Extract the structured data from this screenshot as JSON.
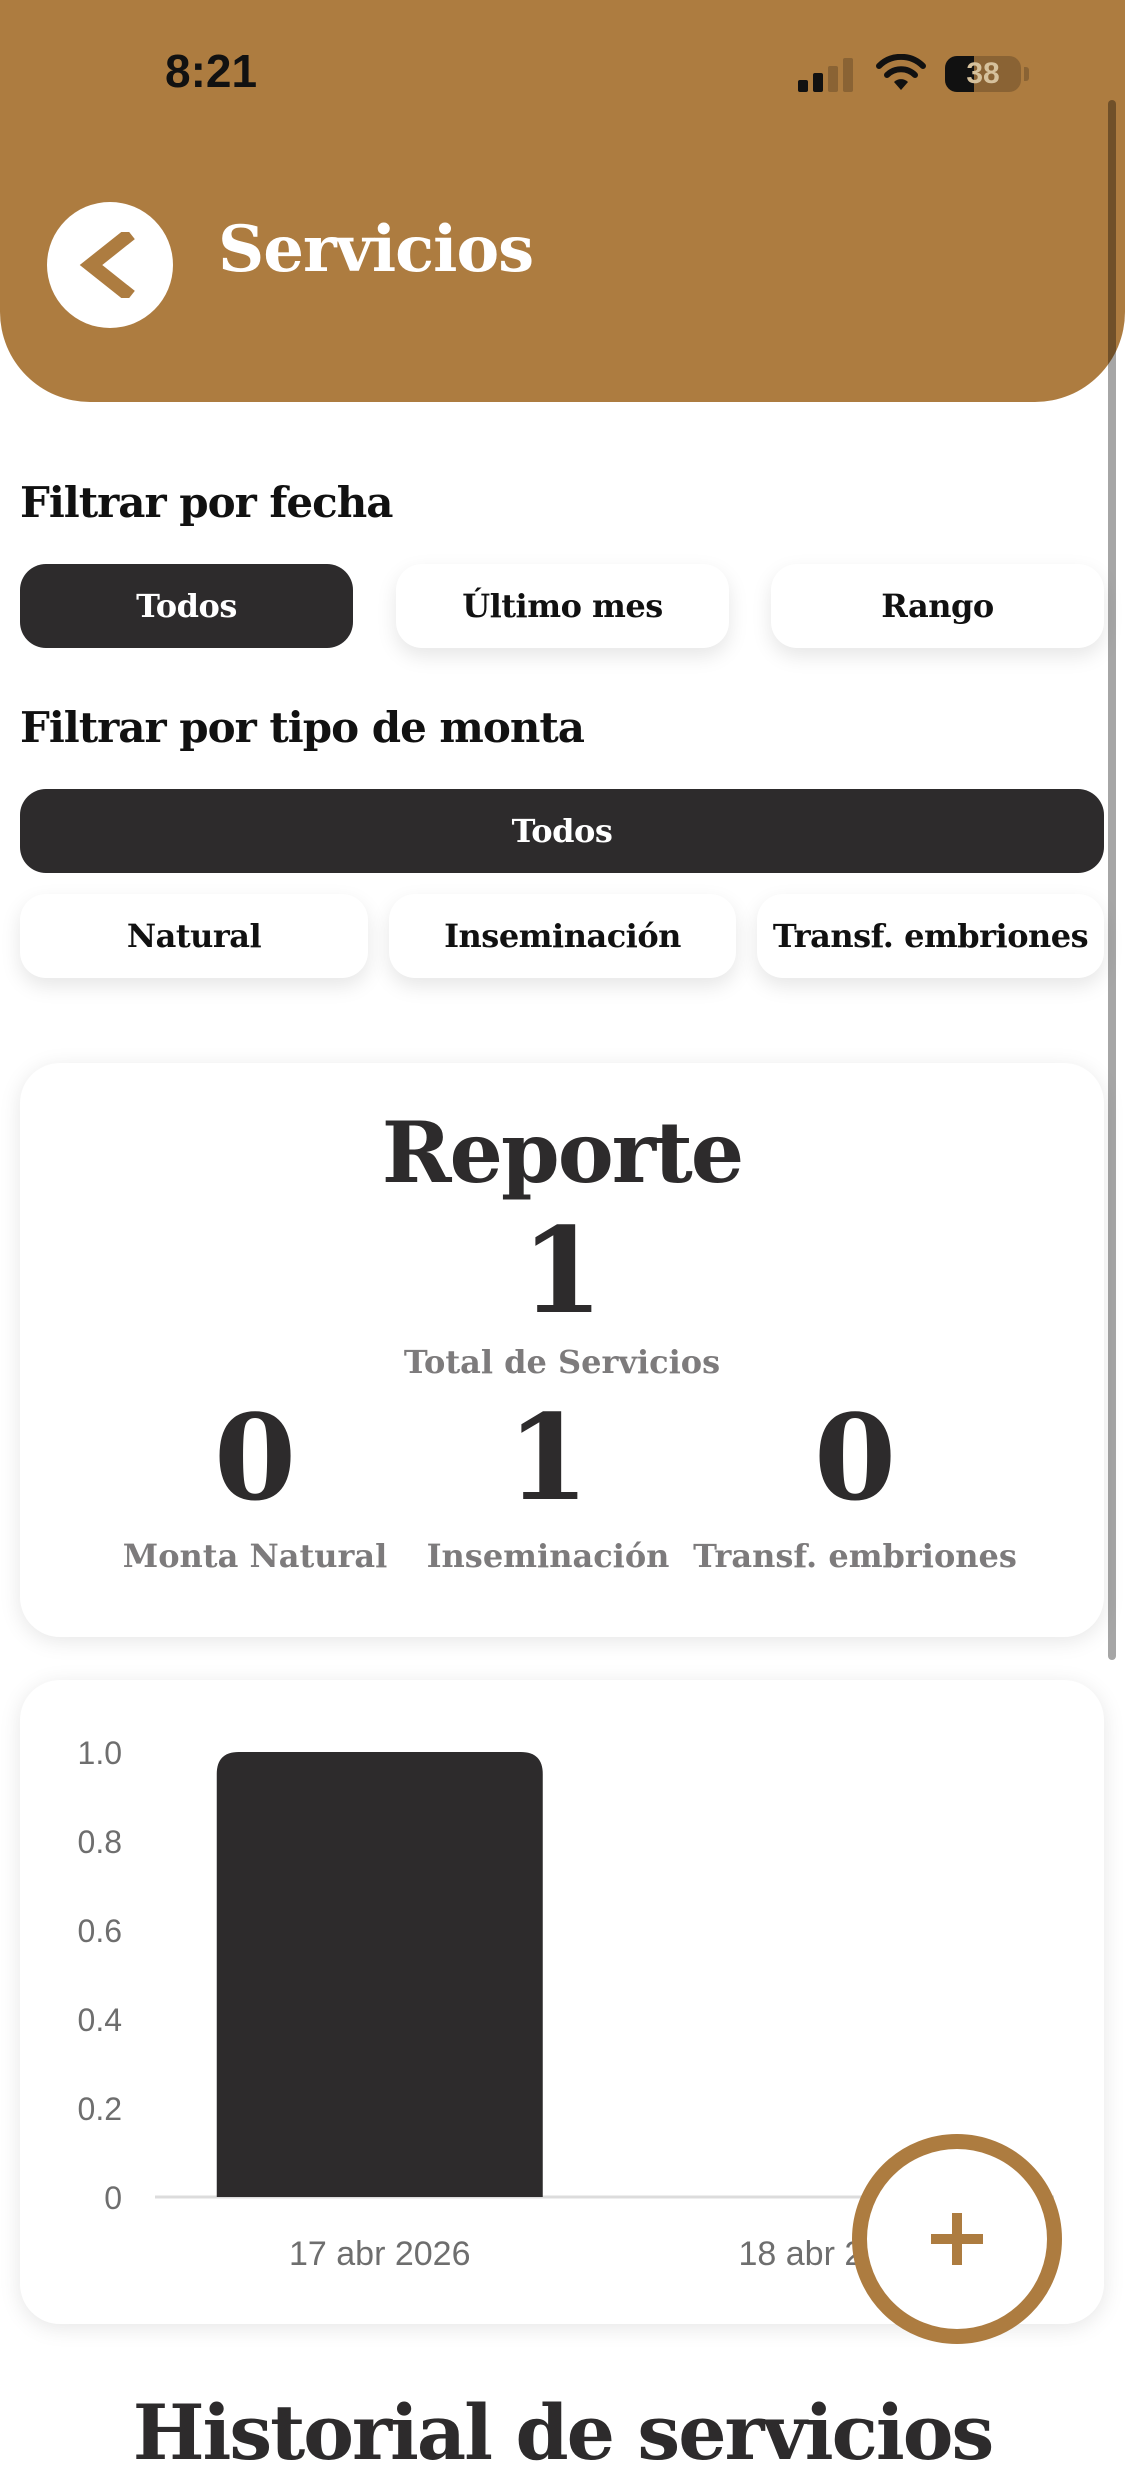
{
  "status_bar": {
    "time": "8:21",
    "battery_level": "38",
    "battery_fraction": 0.38
  },
  "header": {
    "title": "Servicios",
    "back_icon": "chevron-left-icon",
    "background_color": "#ad7c40"
  },
  "date_filter": {
    "label": "Filtrar por fecha",
    "options": [
      "Todos",
      "Último mes",
      "Rango"
    ],
    "selected": "Todos"
  },
  "type_filter": {
    "label": "Filtrar por tipo de monta",
    "all_option": "Todos",
    "options": [
      "Natural",
      "Inseminación",
      "Transf. embriones"
    ],
    "selected": "Todos"
  },
  "report": {
    "title": "Reporte",
    "total_value": "1",
    "total_label": "Total de Servicios",
    "stats": [
      {
        "value": "0",
        "label": "Monta Natural"
      },
      {
        "value": "1",
        "label": "Inseminación"
      },
      {
        "value": "0",
        "label": "Transf. embriones"
      }
    ]
  },
  "chart_data": {
    "type": "bar",
    "categories": [
      "17 abr 2026",
      "18 abr 2026"
    ],
    "values": [
      1,
      0
    ],
    "ylim": [
      0,
      1.0
    ],
    "yticks": [
      "0",
      "0.2",
      "0.4",
      "0.6",
      "0.8",
      "1.0"
    ],
    "xlabel": "",
    "ylabel": "",
    "grid": false,
    "bar_color": "#2d2b2c"
  },
  "fab": {
    "icon": "plus-icon",
    "color": "#ad7c40"
  },
  "history": {
    "title": "Historial de servicios"
  }
}
